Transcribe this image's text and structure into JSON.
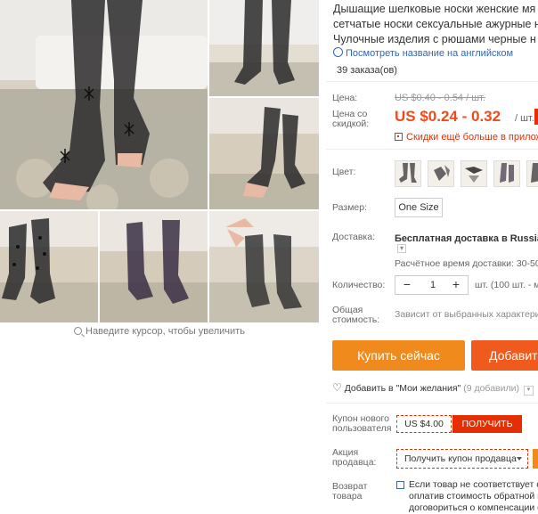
{
  "product": {
    "title_lines": [
      "Дышащие шелковые носки женские мя",
      "сетчатые носки сексуальные ажурные н",
      "Чулочные изделия с рюшами черные н"
    ],
    "translate_link": "Посмотреть название на английском",
    "orders": "39 заказа(ов)"
  },
  "gallery": {
    "zoom_hint": "Наведите курсор, чтобы увеличить"
  },
  "price": {
    "label": "Цена:",
    "old": "US $0.40 - 0.54 / шт.",
    "sale_label": "Цена со скидкой:",
    "current": "US $0.24 - 0.32",
    "unit": "/ шт.",
    "app_discount": "Скидки ещё больше в приложе"
  },
  "options": {
    "color_label": "Цвет:",
    "size_label": "Размер:",
    "size_value": "One Size"
  },
  "shipping": {
    "label": "Доставка:",
    "main": "Бесплатная доставка в Russian F",
    "time": "Расчётное время доставки: 30-50"
  },
  "quantity": {
    "label": "Количество:",
    "minus": "−",
    "value": "1",
    "plus": "+",
    "available": "шт. (100 шт. - ма"
  },
  "total": {
    "label": "Общая стоимость:",
    "value": "Зависит от выбранных характери"
  },
  "actions": {
    "buy_now": "Купить сейчас",
    "add_to_cart": "Добавит",
    "wishlist": "Добавить в \"Мои желания\"",
    "wishlist_count": "(9 добавили)"
  },
  "coupon": {
    "new_user_label": "Купон нового пользователя",
    "new_user_value": "US $4.00",
    "get_button": "ПОЛУЧИТЬ",
    "seller_label": "Акция продавца:",
    "seller_select": "Получить купон продавца"
  },
  "returns": {
    "label": "Возврат товара",
    "lines": [
      "Если товар не соответствует о",
      "оплатив стоимость обратной п",
      "договориться о компенсации с"
    ]
  },
  "colors": {
    "accent": "#f04a1c",
    "buy": "#f18a1d",
    "cart": "#f15a1d",
    "link": "#3266b5",
    "red": "#e62e04"
  }
}
